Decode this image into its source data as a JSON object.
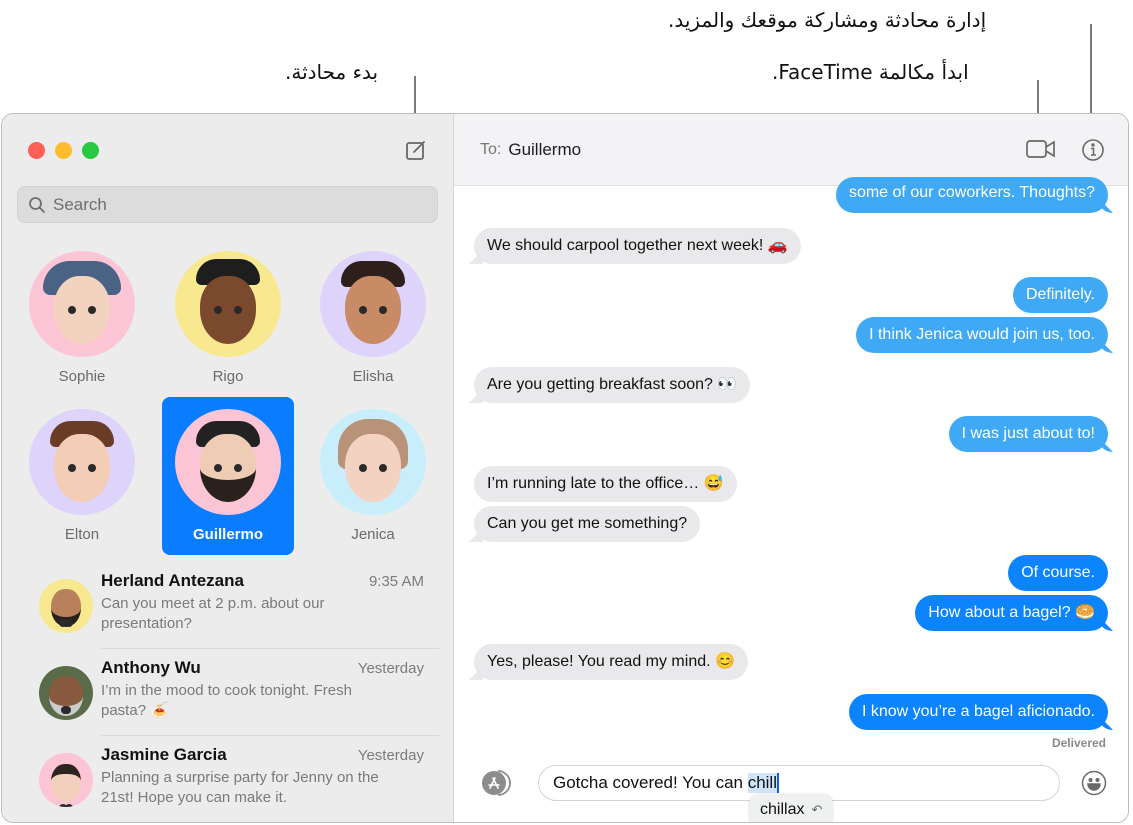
{
  "callouts": {
    "manage": "إدارة محادثة ومشاركة موقعك والمزيد.",
    "facetime": "ابدأ مكالمة FaceTime.",
    "new_conversation": "بدء محادثة."
  },
  "sidebar": {
    "search_placeholder": "Search",
    "pinned": [
      {
        "name": "Sophie",
        "bg": "#fcc5d6",
        "selected": false
      },
      {
        "name": "Rigo",
        "bg": "#f8e88f",
        "selected": false
      },
      {
        "name": "Elisha",
        "bg": "#ddd3fb",
        "selected": false
      },
      {
        "name": "Elton",
        "bg": "#ddd3fb",
        "selected": false
      },
      {
        "name": "Guillermo",
        "bg": "#fcc5d6",
        "selected": true
      },
      {
        "name": "Jenica",
        "bg": "#c9eefb",
        "selected": false
      }
    ],
    "conversations": [
      {
        "name": "Herland Antezana",
        "time": "9:35 AM",
        "preview": "Can you meet at 2 p.m. about our presentation?"
      },
      {
        "name": "Anthony Wu",
        "time": "Yesterday",
        "preview": "I’m in the mood to cook tonight. Fresh pasta? 🍝"
      },
      {
        "name": "Jasmine Garcia",
        "time": "Yesterday",
        "preview": "Planning a surprise party for Jenny on the 21st! Hope you can make it."
      }
    ]
  },
  "header": {
    "to_label": "To:",
    "recipient": "Guillermo"
  },
  "messages": [
    {
      "dir": "out",
      "text": "some of our coworkers. Thoughts?"
    },
    {
      "dir": "in",
      "text": "We should carpool together next week! 🚗"
    },
    {
      "dir": "out",
      "text": "Definitely."
    },
    {
      "dir": "out",
      "text": "I think Jenica would join us, too."
    },
    {
      "dir": "in",
      "text": "Are you getting breakfast soon? 👀"
    },
    {
      "dir": "out",
      "text": "I was just about to!"
    },
    {
      "dir": "in",
      "text": "I’m running late to the office… 😅"
    },
    {
      "dir": "in",
      "text": "Can you get me something?"
    },
    {
      "dir": "out",
      "text": "Of course."
    },
    {
      "dir": "out",
      "text": "How about a bagel? 🥯"
    },
    {
      "dir": "in",
      "text": "Yes, please! You read my mind. 😊"
    },
    {
      "dir": "out",
      "text": "I know you’re a bagel aficionado."
    }
  ],
  "status": "Delivered",
  "compose": {
    "text_before": "Gotcha covered! You can ",
    "text_selected": "chill",
    "suggestion": "chillax",
    "suggestion_icon": "undo-icon"
  },
  "icons": {
    "compose": "compose-icon",
    "facetime": "video-camera-icon",
    "info": "info-icon",
    "apps": "app-store-icon",
    "emoji": "emoji-icon",
    "search": "search-icon"
  }
}
